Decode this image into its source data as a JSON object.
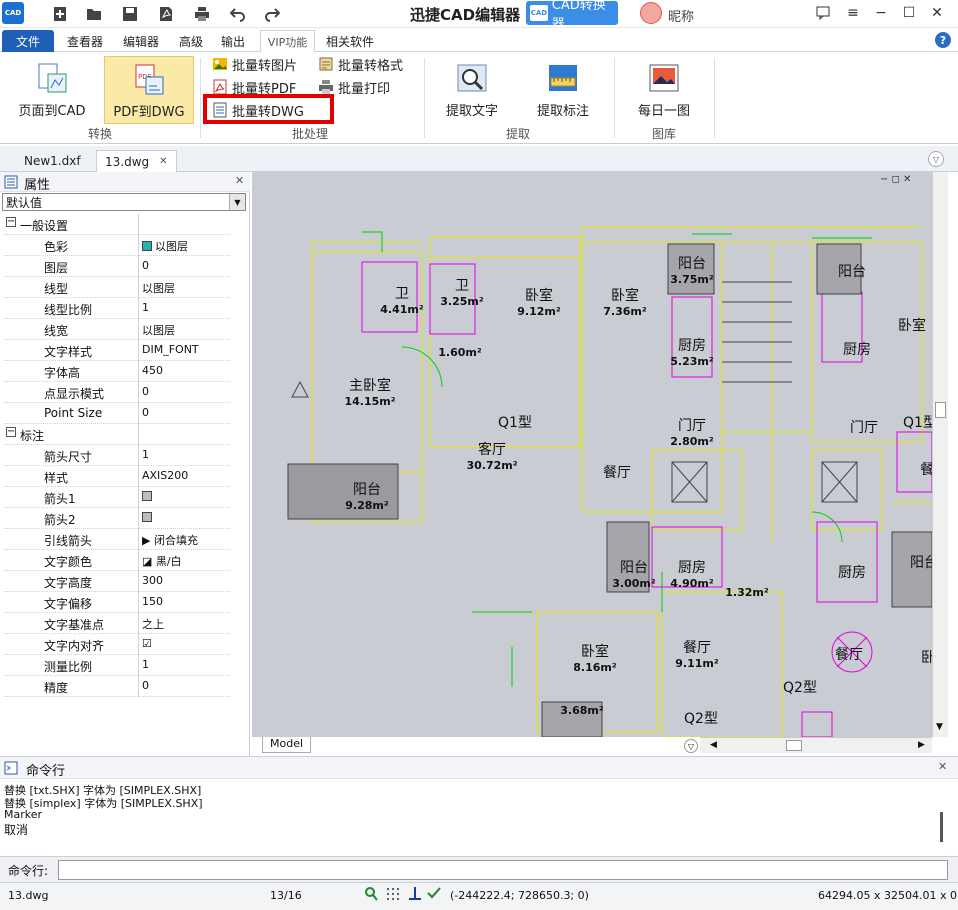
{
  "titlebar": {
    "logo_text": "CAD",
    "app_title": "迅捷CAD编辑器",
    "converter_logo": "CAD",
    "converter_label": "CAD转换器",
    "nickname": "昵称",
    "quick_icons": [
      "new-file-icon",
      "open-folder-icon",
      "save-icon",
      "pdf-icon",
      "print-icon",
      "undo-icon",
      "redo-icon"
    ],
    "window_icons": [
      "feedback-icon",
      "menu-icon",
      "minimize-icon",
      "maximize-icon",
      "close-icon"
    ]
  },
  "ribbon_tabs": [
    "文件",
    "查看器",
    "编辑器",
    "高级",
    "输出",
    "VIP功能",
    "相关软件"
  ],
  "active_tab": "VIP功能",
  "help": "?",
  "ribbon": {
    "convert_group": {
      "label": "转换",
      "buttons": [
        "页面到CAD",
        "PDF到DWG"
      ]
    },
    "batch_group": {
      "label": "批处理",
      "buttons": [
        "批量转图片",
        "批量转格式",
        "批量转PDF",
        "批量打印",
        "批量转DWG"
      ]
    },
    "extract_group": {
      "label": "提取",
      "buttons": [
        "提取文字",
        "提取标注"
      ]
    },
    "gallery_group": {
      "label": "图库",
      "buttons": [
        "每日一图"
      ]
    },
    "highlight_color": "#e00000"
  },
  "doc_tabs": [
    "New1.dxf",
    "13.dwg"
  ],
  "active_doc": "13.dwg",
  "properties": {
    "title": "属性",
    "select_value": "默认值",
    "rows": [
      {
        "key": "一般设置",
        "value": "",
        "section": true
      },
      {
        "key": "色彩",
        "value": "以图层",
        "swatch": "#23b3b3"
      },
      {
        "key": "图层",
        "value": "0"
      },
      {
        "key": "线型",
        "value": "以图层"
      },
      {
        "key": "线型比例",
        "value": "1"
      },
      {
        "key": "线宽",
        "value": "以图层"
      },
      {
        "key": "文字样式",
        "value": "DIM_FONT"
      },
      {
        "key": "字体高",
        "value": "450"
      },
      {
        "key": "点显示模式",
        "value": "0"
      },
      {
        "key": "Point Size",
        "value": "0"
      },
      {
        "key": "标注",
        "value": "",
        "section": true
      },
      {
        "key": "箭头尺寸",
        "value": "1"
      },
      {
        "key": "样式",
        "value": "AXIS200"
      },
      {
        "key": "箭头1",
        "value": "",
        "swatch": "#bdbdbd"
      },
      {
        "key": "箭头2",
        "value": "",
        "swatch": "#bdbdbd"
      },
      {
        "key": "引线箭头",
        "value": "▶ 闭合填充"
      },
      {
        "key": "文字颜色",
        "value": "◪ 黑/白"
      },
      {
        "key": "文字高度",
        "value": "300"
      },
      {
        "key": "文字偏移",
        "value": "150"
      },
      {
        "key": "文字基准点",
        "value": "之上"
      },
      {
        "key": "文字内对齐",
        "value": "☑"
      },
      {
        "key": "测量比例",
        "value": "1"
      },
      {
        "key": "精度",
        "value": "0"
      }
    ]
  },
  "drawing": {
    "rooms": [
      {
        "name": "卫",
        "area": "4.41m²"
      },
      {
        "name": "卫",
        "area": "3.25m²"
      },
      {
        "name": "卧室",
        "area": "9.12m²"
      },
      {
        "name": "卧室",
        "area": "7.36m²"
      },
      {
        "name": "阳台",
        "area": "3.75m²"
      },
      {
        "name": "阳台",
        "area": ""
      },
      {
        "name": "卧室",
        "area": ""
      },
      {
        "name": "",
        "area": "1.60m²"
      },
      {
        "name": "厨房",
        "area": "5.23m²"
      },
      {
        "name": "厨房",
        "area": ""
      },
      {
        "name": "主卧室",
        "area": "14.15m²"
      },
      {
        "name": "Q1型",
        "area": ""
      },
      {
        "name": "门厅",
        "area": "2.80m²"
      },
      {
        "name": "门厅",
        "area": ""
      },
      {
        "name": "Q1型",
        "area": ""
      },
      {
        "name": "客厅",
        "area": "30.72m²"
      },
      {
        "name": "餐厅",
        "area": ""
      },
      {
        "name": "餐",
        "area": ""
      },
      {
        "name": "阳台",
        "area": "9.28m²"
      },
      {
        "name": "阳台",
        "area": "3.00m²"
      },
      {
        "name": "厨房",
        "area": "4.90m²"
      },
      {
        "name": "",
        "area": "1.32m²"
      },
      {
        "name": "厨房",
        "area": ""
      },
      {
        "name": "阳台",
        "area": ""
      },
      {
        "name": "卧室",
        "area": "8.16m²"
      },
      {
        "name": "餐厅",
        "area": "9.11m²"
      },
      {
        "name": "餐厅",
        "area": ""
      },
      {
        "name": "卧",
        "area": ""
      },
      {
        "name": "Q2型",
        "area": ""
      },
      {
        "name": "",
        "area": "3.68m²"
      },
      {
        "name": "Q2型",
        "area": ""
      }
    ],
    "model_tab": "Model",
    "view_controls": "− ◻ ✕"
  },
  "command": {
    "title": "命令行",
    "lines": [
      "替换 [txt.SHX] 字体为 [SIMPLEX.SHX]",
      "替换 [simplex] 字体为 [SIMPLEX.SHX]",
      "Marker",
      "取消"
    ],
    "prompt": "命令行:"
  },
  "status": {
    "file": "13.dwg",
    "page": "13/16",
    "coords": "(-244222.4; 728650.3; 0)",
    "extent": "64294.05 x 32504.01 x 0"
  }
}
